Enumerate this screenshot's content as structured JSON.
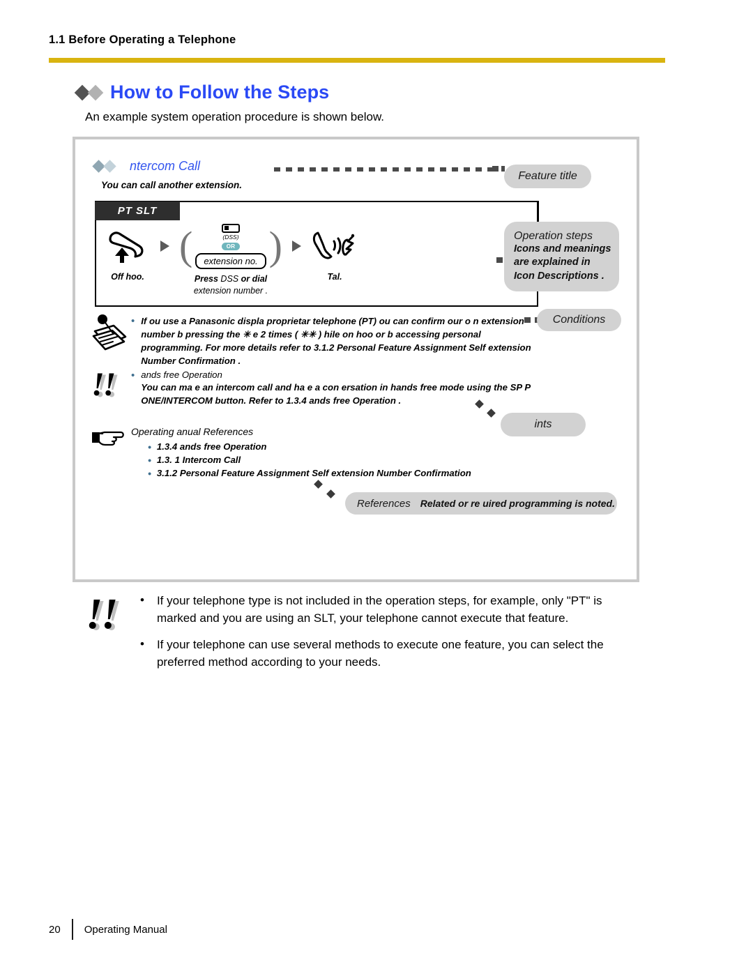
{
  "running_head": "1.1 Before Operating a Telephone",
  "section": {
    "title": "How to Follow the Steps",
    "intro": "An example system operation procedure is shown below."
  },
  "example": {
    "feature_title": "ntercom Call",
    "feature_subtitle": "You can call another extension.",
    "phone_types_tab": "PT SLT",
    "steps": [
      {
        "icon": "offhook-handset-icon",
        "label_bold": "Off hoo",
        "label_rest": "."
      },
      {
        "icon": "dss-key-icon",
        "dss_caption": "(DSS)",
        "or_badge": "OR",
        "ext_pill": "extension no.",
        "label_bold": "Press",
        "label_mid": "DSS",
        "label_bold2": "or dial",
        "label_line2": "extension number  ."
      },
      {
        "icon": "talk-handset-icon",
        "label_bold": "Tal",
        "label_rest": "."
      }
    ],
    "conditions": {
      "icon": "memo-note-icon",
      "bullets": [
        "If  ou use a Panasonic displa   proprietar  telephone (PT)   ou can confirm  our o n extension number b  pressing the  ✳   e  2 times ( ✳✳ )   hile on hoo   or b  accessing personal programming. For more details  refer to  3.1.2 Personal Feature Assignment  Self extension Number Confirmation ."
      ]
    },
    "hints": {
      "icon": "double-exclamation-icon",
      "heading": "ands free Operation",
      "body": "You can ma e an intercom call and ha e a con ersation in hands free mode using the SP P  ONE/INTERCOM button. Refer to  1.3.4    ands free Operation ."
    },
    "references": {
      "icon": "pointing-hand-icon",
      "heading": "Operating   anual References",
      "items": [
        "1.3.4    ands free Operation",
        "1.3.  1 Intercom Call",
        "3.1.2 Personal Feature Assignment   Self extension Number Confirmation"
      ]
    },
    "callouts": {
      "feature_title": "Feature title",
      "operation_steps_lead": "Operation steps",
      "operation_steps_body": "Icons and meanings\nare explained in\n Icon Descriptions .",
      "conditions": "Conditions",
      "hints": "ints",
      "references_lead": "References",
      "references_body": "Related or re  uired programming is noted."
    }
  },
  "bottom_notes": {
    "icon": "double-exclamation-icon",
    "items": [
      "If your telephone type is not included in the operation steps, for example, only \"PT\" is marked and you are using an SLT, your telephone cannot execute that feature.",
      "If your telephone can use several methods to execute one feature, you can select the preferred method according to your needs."
    ]
  },
  "footer": {
    "page_number": "20",
    "manual_name": "Operating Manual"
  },
  "colors": {
    "rule": "#d9b410",
    "heading_blue": "#2a49f5",
    "feature_blue": "#3355ee",
    "callout_grey": "#d2d2d2",
    "tab_black": "#2e2e2e",
    "or_badge_teal": "#6fb6bd"
  }
}
